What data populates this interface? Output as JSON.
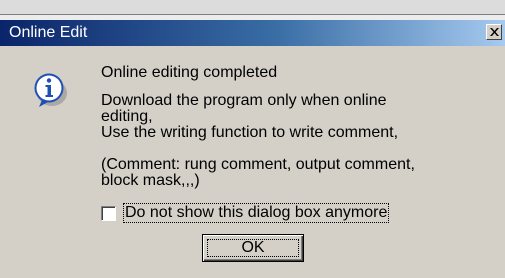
{
  "dialog": {
    "title": "Online Edit",
    "close_glyph": "×",
    "icon": "info-icon",
    "messages": {
      "line1": "Online editing completed",
      "line2": "Download the program only when online",
      "line3": "editing,",
      "line4": "Use the writing function to write comment,",
      "line5": "(Comment: rung comment, output comment,",
      "line6": "block mask,,,)"
    },
    "checkbox": {
      "label": "Do not show this dialog box anymore",
      "checked": false
    },
    "ok_label": "OK"
  },
  "colors": {
    "titlebar_start": "#0a246a",
    "titlebar_end": "#a6caf0",
    "face": "#d4d0c8",
    "info_blue": "#1e50b4"
  }
}
